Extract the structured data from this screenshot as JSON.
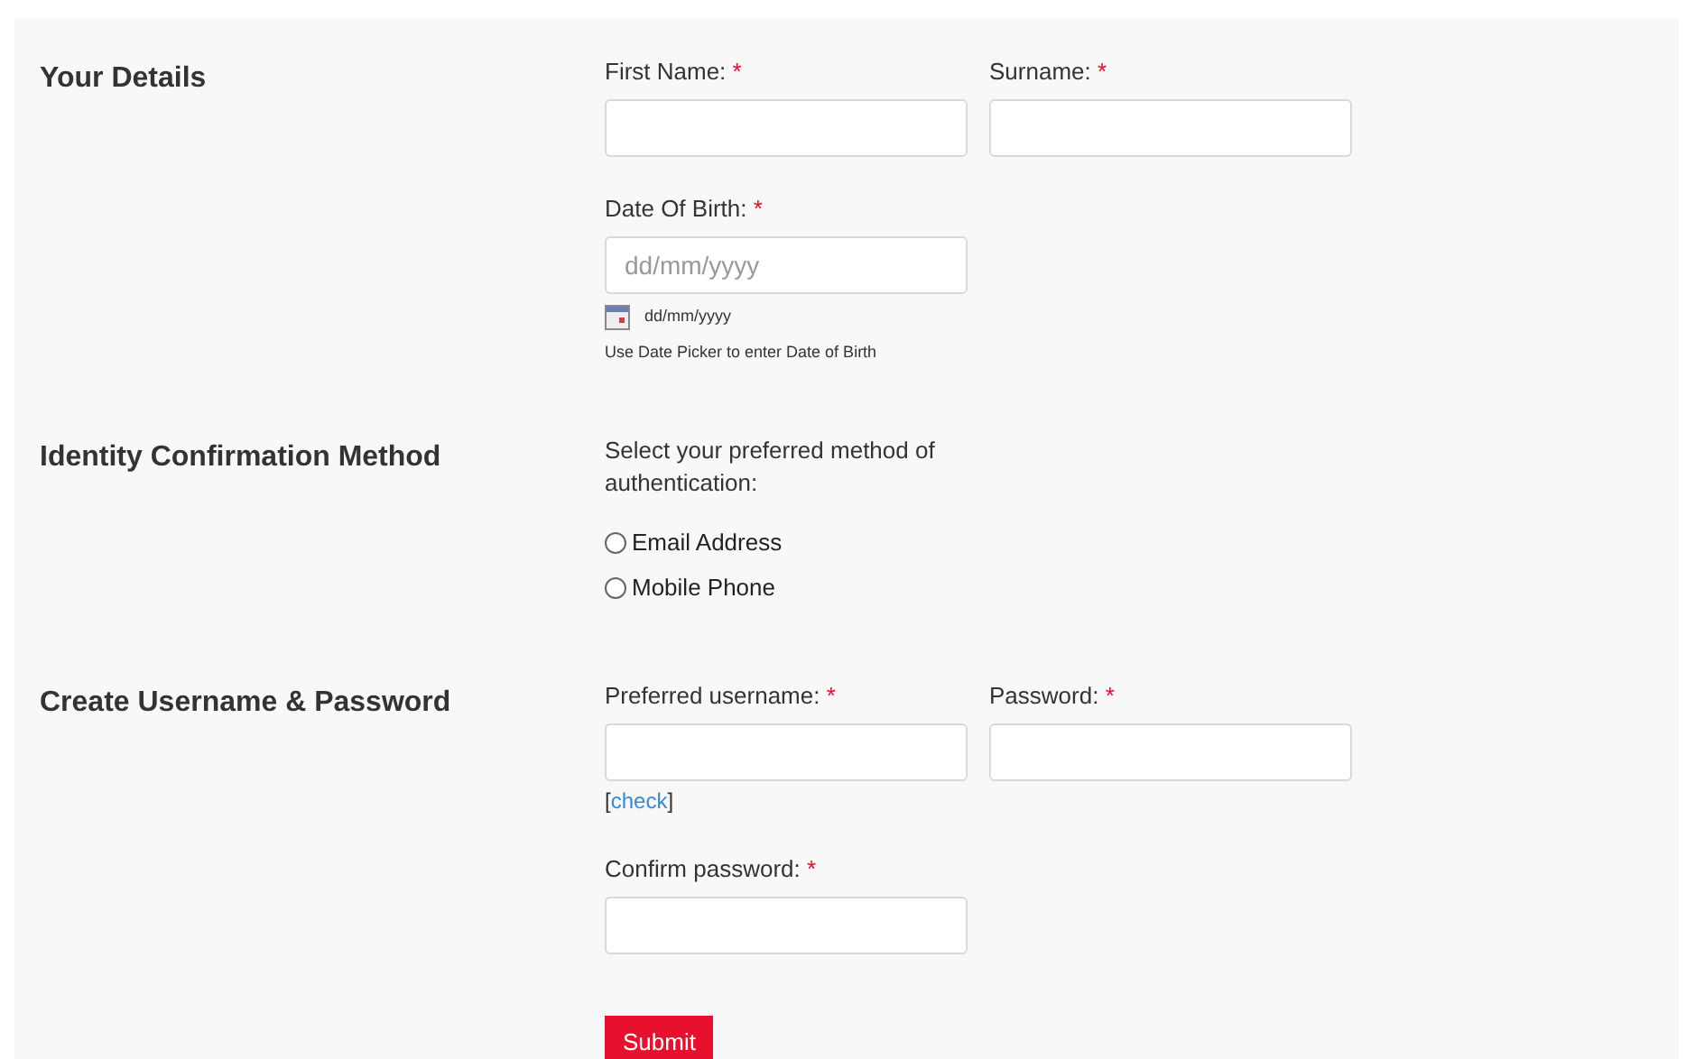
{
  "sections": [
    {
      "title": "Your Details",
      "kind": "fields",
      "rows": [
        [
          {
            "label": "First Name:",
            "mark": "*"
          },
          {
            "label": "Surname:",
            "mark": "*"
          }
        ],
        [
          {
            "label": "Date Of Birth:",
            "mark": "*",
            "placeholder": "dd/mm/yyyy",
            "format": "dd/mm/yyyy",
            "hint": "Use Date Picker to enter Date of Birth"
          }
        ]
      ]
    },
    {
      "title": "Identity Confirmation Method",
      "kind": "radio",
      "prompt": "Select your preferred method of authentication:",
      "options": [
        {
          "label": "Email Address",
          "selected": false
        },
        {
          "label": "Mobile Phone",
          "selected": false
        }
      ]
    },
    {
      "title": "Create Username & Password",
      "kind": "fields",
      "rows": [
        [
          {
            "label": "Preferred username:",
            "mark": "*",
            "link": {
              "before": "[",
              "label": "check",
              "after": "]"
            }
          },
          {
            "label": "Password:",
            "mark": "*"
          }
        ],
        [
          {
            "label": "Confirm password:",
            "mark": "*"
          }
        ]
      ]
    }
  ],
  "submit": "Submit"
}
